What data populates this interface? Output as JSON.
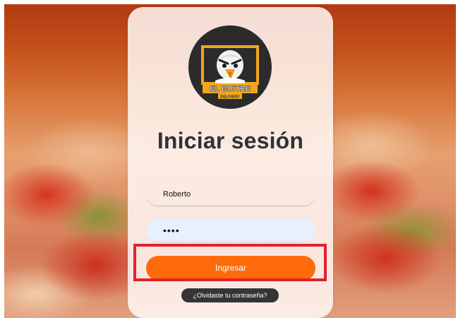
{
  "logo": {
    "brand_name": "EL BUITRE",
    "brand_sub": "DELIVERY"
  },
  "login": {
    "title": "Iniciar sesión",
    "username_value": "Roberto",
    "password_value": "••••",
    "submit_label": "Ingresar",
    "forgot_label": "¿Olvidaste tu contraseña?"
  },
  "colors": {
    "accent": "#ff6a0a",
    "highlight": "#e2212f",
    "title": "#2f3338",
    "forgot_bg": "#333536",
    "password_bg": "#e8f0fe"
  }
}
